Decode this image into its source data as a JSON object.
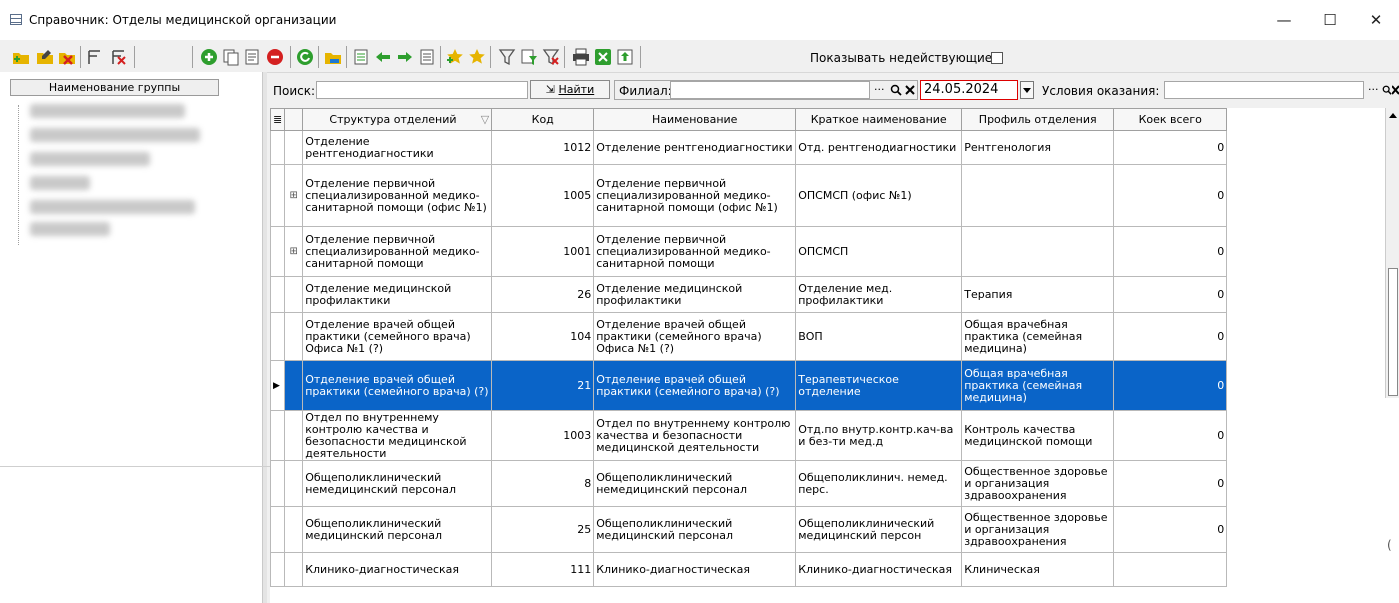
{
  "window": {
    "title": "Справочник: Отделы медицинской организации",
    "minimize": "—",
    "maximize": "☐",
    "close": "✕"
  },
  "toolbar": {
    "icons": [
      "add-group",
      "edit-group",
      "delete-group",
      "filter-columns",
      "clear-filter",
      "add-record",
      "copy-record",
      "edit-record",
      "delete-record",
      "refresh",
      "open-folder",
      "filter",
      "export-left",
      "arrow-left",
      "arrow-right",
      "export-right",
      "star-add",
      "star",
      "funnel",
      "funnel-list",
      "funnel-clear",
      "print",
      "excel",
      "upload"
    ],
    "show_inactive_label": "Показывать недействующие"
  },
  "left": {
    "group_header": "Наименование группы"
  },
  "search": {
    "label": "Поиск:",
    "find_label": "Найти",
    "filial_label": "Филиал:",
    "date": "24.05.2024",
    "conditions_label": "Условия оказания:",
    "dots": "···"
  },
  "grid": {
    "columns": [
      "Структура отделений",
      "Код",
      "Наименование",
      "Краткое наименование",
      "Профиль отделения",
      "Коек всего"
    ],
    "rows": [
      {
        "structure": "Отделение рентгенодиагностики",
        "code": "1012",
        "name": "Отделение рентгенодиагностики",
        "short": "Отд. рентгенодиагностики",
        "profile": "Рентгенология",
        "beds": "0",
        "expand": false,
        "selected": false
      },
      {
        "structure": "Отделение первичной специализированной медико-санитарной помощи (офис №1)",
        "code": "1005",
        "name": "Отделение первичной специализированной медико-санитарной помощи (офис №1)",
        "short": "ОПСМСП (офис №1)",
        "profile": "",
        "beds": "0",
        "expand": true,
        "selected": false
      },
      {
        "structure": "Отделение первичной специализированной медико-санитарной помощи",
        "code": "1001",
        "name": "Отделение первичной специализированной медико-санитарной помощи",
        "short": "ОПСМСП",
        "profile": "",
        "beds": "0",
        "expand": true,
        "selected": false
      },
      {
        "structure": "Отделение медицинской профилактики",
        "code": "26",
        "name": "Отделение медицинской профилактики",
        "short": "Отделение мед. профилактики",
        "profile": "Терапия",
        "beds": "0",
        "expand": false,
        "selected": false
      },
      {
        "structure": "Отделение врачей общей практики (семейного врача) Офиса №1 (?)",
        "code": "104",
        "name": "Отделение врачей общей практики (семейного врача) Офиса №1 (?)",
        "short": "ВОП",
        "profile": "Общая врачебная практика (семейная медицина)",
        "beds": "0",
        "expand": false,
        "selected": false
      },
      {
        "structure": "Отделение врачей общей практики (семейного врача) (?)",
        "code": "21",
        "name": "Отделение врачей общей практики (семейного врача) (?)",
        "short": "Терапевтическое отделение",
        "profile": "Общая врачебная практика (семейная медицина)",
        "beds": "0",
        "expand": false,
        "selected": true
      },
      {
        "structure": "Отдел по внутреннему контролю качества и безопасности медицинской деятельности",
        "code": "1003",
        "name": "Отдел по внутреннему контролю качества и безопасности медицинской деятельности",
        "short": "Отд.по внутр.контр.кач-ва и без-ти мед.д",
        "profile": "Контроль качества медицинской помощи",
        "beds": "0",
        "expand": false,
        "selected": false
      },
      {
        "structure": "Общеполиклинический немедицинский персонал",
        "code": "8",
        "name": "Общеполиклинический немедицинский персонал",
        "short": "Общеполиклинич. немед. перс.",
        "profile": "Общественное здоровье и организация здравоохранения",
        "beds": "0",
        "expand": false,
        "selected": false
      },
      {
        "structure": "Общеполиклинический медицинский персонал",
        "code": "25",
        "name": "Общеполиклинический медицинский персонал",
        "short": "Общеполиклинический медицинский персон",
        "profile": "Общественное здоровье и организация здравоохранения",
        "beds": "0",
        "expand": false,
        "selected": false
      },
      {
        "structure": "Клинико-диагностическая",
        "code": "111",
        "name": "Клинико-диагностическая",
        "short": "Клинико-диагностическая",
        "profile": "Клиническая",
        "beds": "",
        "expand": false,
        "selected": false
      }
    ]
  },
  "colors": {
    "selection": "#0a64c8",
    "date_border": "#dd0000",
    "green": "#2e9e2e",
    "red": "#d42020",
    "yellow": "#e6b400"
  }
}
